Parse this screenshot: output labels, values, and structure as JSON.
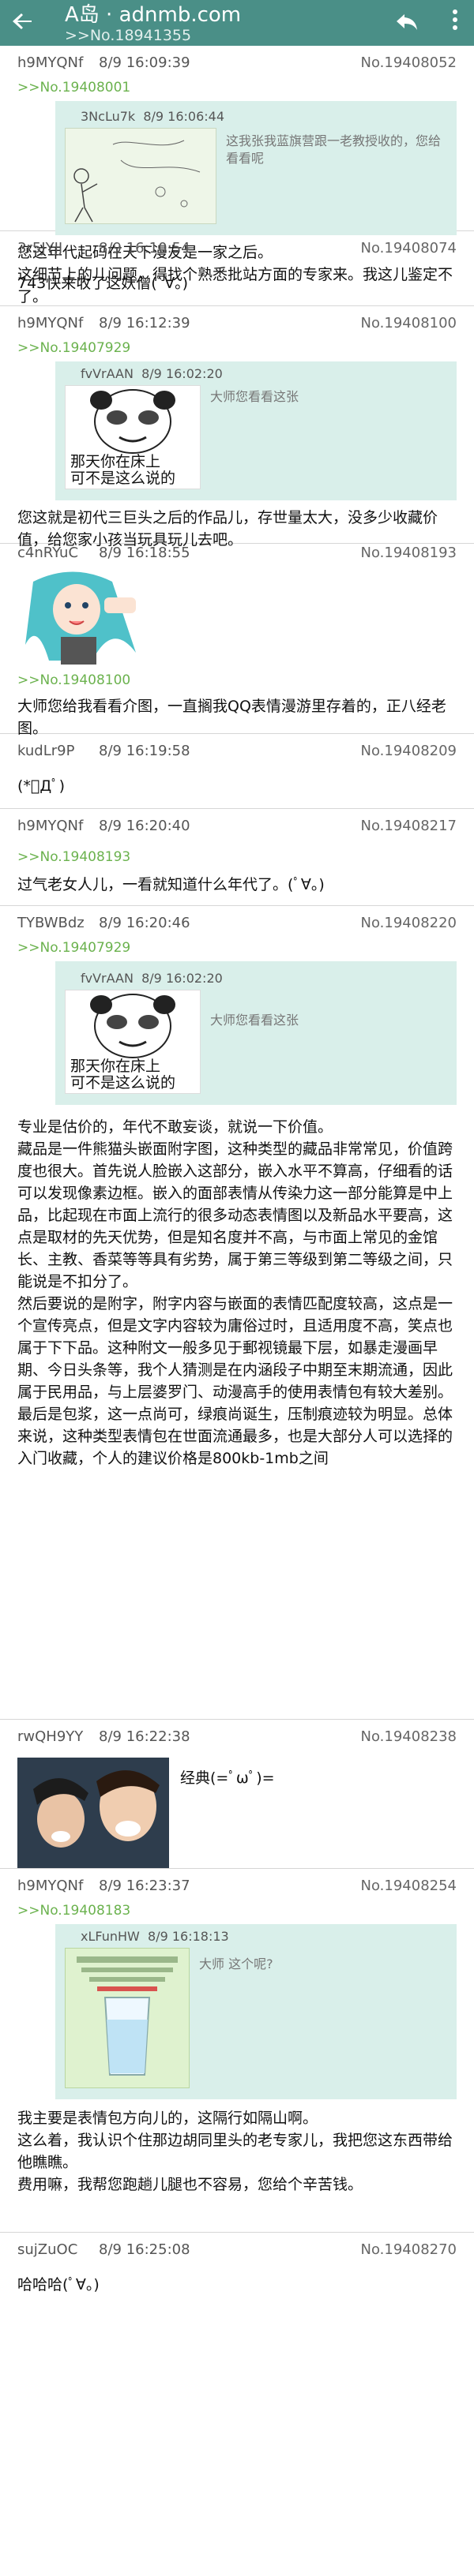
{
  "app": {
    "title": "A岛 · adnmb.com",
    "thread_no": ">>No.18941355"
  },
  "posts": [
    {
      "user": "h9MYQNf",
      "time": "8/9 16:09:39",
      "no": "No.19408052",
      "ref": ">>No.19408001",
      "quote": {
        "user": "3NcLu7k",
        "time": "8/9 16:06:44",
        "text": "这我张我蓝旗营跟一老教授收的，您给看看呢"
      },
      "content": [
        "您这年代起码在天下漫友是一家之后。",
        "这细节上的儿问题，得找个熟悉批站方面的专家来。我这儿鉴定不了。"
      ]
    },
    {
      "user": "3r5JYJJ",
      "time": "8/9 16:10:54",
      "no": "No.19408074",
      "content": [
        "743快来收了这妖僧(ﾟ∀。)"
      ]
    },
    {
      "user": "h9MYQNf",
      "time": "8/9 16:12:39",
      "no": "No.19408100",
      "ref": ">>No.19407929",
      "quote": {
        "user": "fvVrAAN",
        "time": "8/9 16:02:20",
        "text": "大师您看看这张",
        "img_line1": "那天你在床上",
        "img_line2": "可不是这么说的"
      },
      "content": [
        "您这就是初代三巨头之后的作品儿，存世量太大，没多少收藏价值，给您家小孩当玩具玩儿去吧。"
      ]
    },
    {
      "user": "c4nRYuC",
      "time": "8/9 16:18:55",
      "no": "No.19408193",
      "ref": ">>No.19408100",
      "content": [
        "大师您给我看看介图，一直搁我QQ表情漫游里存着的，正八经老图。"
      ]
    },
    {
      "user": "kudLr9P",
      "time": "8/9 16:19:58",
      "no": "No.19408209",
      "content": [
        "(*ﾟДﾟ)"
      ]
    },
    {
      "user": "h9MYQNf",
      "time": "8/9 16:20:40",
      "no": "No.19408217",
      "ref": ">>No.19408193",
      "content": [
        "过气老女人儿，一看就知道什么年代了。(ﾟ∀。)"
      ]
    },
    {
      "user": "TYBWBdz",
      "time": "8/9 16:20:46",
      "no": "No.19408220",
      "ref": ">>No.19407929",
      "quote": {
        "user": "fvVrAAN",
        "time": "8/9 16:02:20",
        "text": "大师您看看这张",
        "img_line1": "那天你在床上",
        "img_line2": "可不是这么说的"
      },
      "content": [
        "专业是估价的，年代不敢妄谈，就说一下价值。",
        "藏品是一件熊猫头嵌面附字图，这种类型的藏品非常常见，价值跨度也很大。首先说人脸嵌入这部分，嵌入水平不算高，仔细看的话可以发现像素边框。嵌入的面部表情从传染力这一部分能算是中上品，比起现在市面上流行的很多动态表情图以及新品水平要高，这点是取材的先天优势，但是知名度并不高，与市面上常见的金馆长、主教、香菜等等具有劣势，属于第三等级到第二等级之间，只能说是不扣分了。",
        "然后要说的是附字，附字内容与嵌面的表情匹配度较高，这点是一个宣传亮点，但是文字内容较为庸俗过时，且适用度不高，笑点也属于下下品。这种附文一般多见于郵视镜最下层，如暴走漫画早期、今日头条等，我个人猜测是在内涵段子中期至末期流通，因此属于民用品，与上层婆罗门、动漫高手的使用表情包有较大差别。",
        "最后是包浆，这一点尚可，绿痕尚诞生，压制痕迹较为明显。总体来说，这种类型表情包在世面流通最多，也是大部分人可以选择的入门收藏，个人的建议价格是800kb-1mb之间"
      ]
    },
    {
      "user": "rwQH9YY",
      "time": "8/9 16:22:38",
      "no": "No.19408238",
      "content": [
        "经典(=ﾟωﾟ)="
      ]
    },
    {
      "user": "h9MYQNf",
      "time": "8/9 16:23:37",
      "no": "No.19408254",
      "ref": ">>No.19408183",
      "quote": {
        "user": "xLFunHW",
        "time": "8/9 16:18:13",
        "text": "大师 这个呢?"
      },
      "content": [
        "我主要是表情包方向儿的，这隔行如隔山啊。",
        "这么着，我认识个住那边胡同里头的老专家儿，我把您这东西带给他瞧瞧。",
        "费用嘛，我帮您跑趟儿腿也不容易，您给个辛苦钱。"
      ]
    },
    {
      "user": "sujZuOC",
      "time": "8/9 16:25:08",
      "no": "No.19408270",
      "content": [
        "哈哈哈(ﾟ∀。)"
      ]
    }
  ],
  "colors": {
    "appbar": "#4a8f87",
    "ref": "#6bb24e",
    "quote_bg": "#d9efea"
  }
}
